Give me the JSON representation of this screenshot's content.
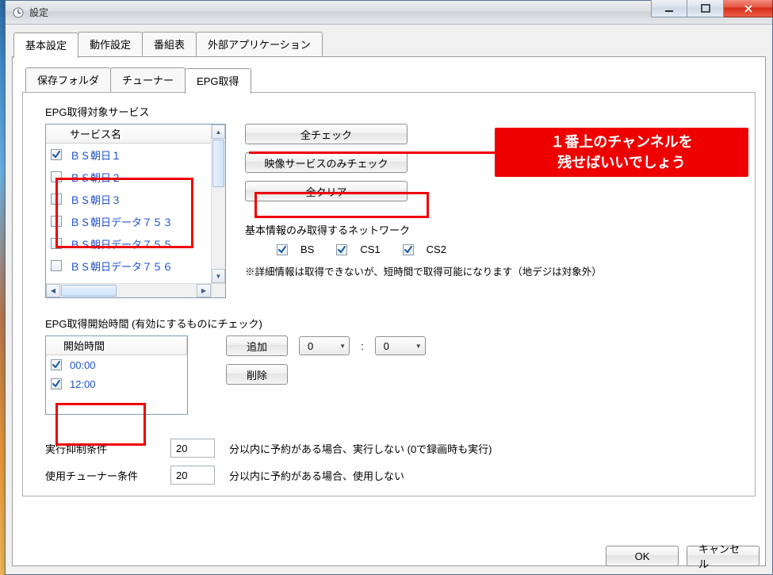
{
  "window": {
    "title": "設定"
  },
  "primary_tabs": {
    "basic": "基本設定",
    "operation": "動作設定",
    "schedule": "番組表",
    "external": "外部アプリケーション"
  },
  "secondary_tabs": {
    "save_folder": "保存フォルダ",
    "tuner": "チューナー",
    "epg": "EPG取得"
  },
  "epg": {
    "section_label": "EPG取得対象サービス",
    "service_header": "サービス名",
    "services": [
      {
        "label": "ＢＳ朝日１",
        "checked": true
      },
      {
        "label": "ＢＳ朝日２",
        "checked": false
      },
      {
        "label": "ＢＳ朝日３",
        "checked": false
      },
      {
        "label": "ＢＳ朝日データ７５３",
        "checked": false
      },
      {
        "label": "ＢＳ朝日データ７５５",
        "checked": false
      },
      {
        "label": "ＢＳ朝日データ７５６",
        "checked": false
      }
    ],
    "btn_check_all": "全チェック",
    "btn_video_only": "映像サービスのみチェック",
    "btn_clear_all": "全クリア",
    "basic_network_label": "基本情報のみ取得するネットワーク",
    "networks": {
      "bs": {
        "label": "BS",
        "checked": true
      },
      "cs1": {
        "label": "CS1",
        "checked": true
      },
      "cs2": {
        "label": "CS2",
        "checked": true
      }
    },
    "basic_note": "※詳細情報は取得できないが、短時間で取得可能になります（地デジは対象外）"
  },
  "start_times": {
    "section_label": "EPG取得開始時間 (有効にするものにチェック)",
    "header": "開始時間",
    "items": [
      {
        "label": "00:00",
        "checked": true
      },
      {
        "label": "12:00",
        "checked": true
      }
    ],
    "btn_add": "追加",
    "btn_delete": "削除",
    "hour_value": "0",
    "minute_value": "0",
    "colon": ":"
  },
  "suppress": {
    "label": "実行抑制条件",
    "value": "20",
    "suffix": "分以内に予約がある場合、実行しない   (0で録画時も実行)"
  },
  "tuner_cond": {
    "label": "使用チューナー条件",
    "value": "20",
    "suffix": "分以内に予約がある場合、使用しない"
  },
  "callout": {
    "text": "１番上のチャンネルを\n残せばいいでしょう"
  },
  "footer": {
    "ok": "OK",
    "cancel": "キャンセル"
  }
}
